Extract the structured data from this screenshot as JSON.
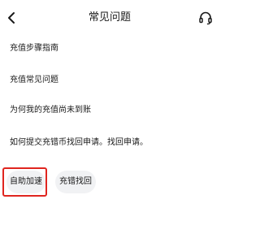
{
  "header": {
    "title": "常见问题",
    "back_icon": "chevron-left-icon",
    "support_icon": "headset-icon"
  },
  "faq_items": [
    {
      "label": "充值步骤指南"
    },
    {
      "label": "充值常见问题"
    },
    {
      "label": "为何我的充值尚未到账"
    },
    {
      "label": "如何提交充错币找回申请。找回申请。"
    }
  ],
  "chips": {
    "self_service": "自助加速",
    "wrong_coin_recovery": "充错找回"
  },
  "colors": {
    "text": "#1a1a1a",
    "chip_bg": "#f1f2f4",
    "highlight_frame": "#e0251f"
  }
}
